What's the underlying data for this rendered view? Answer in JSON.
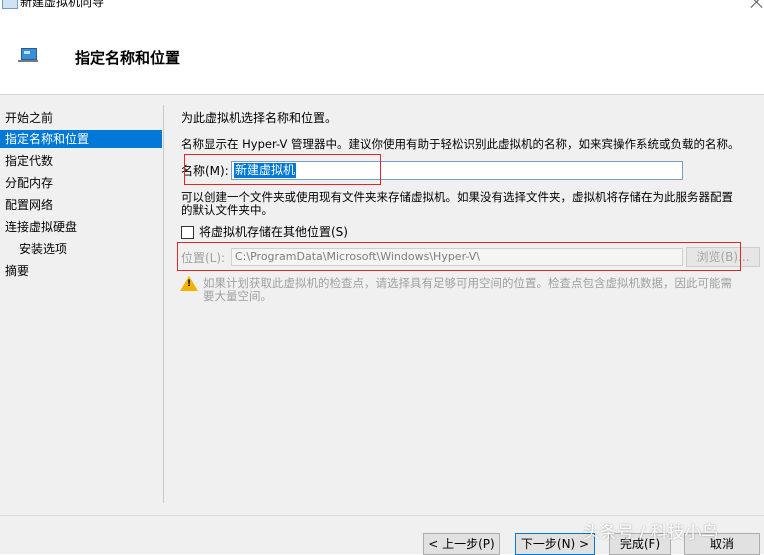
{
  "window": {
    "title": "新建虚拟机向导",
    "close_icon": "close-icon"
  },
  "header": {
    "heading": "指定名称和位置",
    "icon": "virtual-machine-icon"
  },
  "nav": {
    "items": [
      {
        "label": "开始之前",
        "selected": false,
        "indent": false
      },
      {
        "label": "指定名称和位置",
        "selected": true,
        "indent": false
      },
      {
        "label": "指定代数",
        "selected": false,
        "indent": false
      },
      {
        "label": "分配内存",
        "selected": false,
        "indent": false
      },
      {
        "label": "配置网络",
        "selected": false,
        "indent": false
      },
      {
        "label": "连接虚拟硬盘",
        "selected": false,
        "indent": false
      },
      {
        "label": "安装选项",
        "selected": false,
        "indent": true
      },
      {
        "label": "摘要",
        "selected": false,
        "indent": false
      }
    ]
  },
  "main": {
    "intro": "为此虚拟机选择名称和位置。",
    "name_desc": "名称显示在 Hyper-V 管理器中。建议你使用有助于轻松识别此虚拟机的名称，如来宾操作系统或负载的名称。",
    "name_label": "名称(M):",
    "name_value": "新建虚拟机",
    "folder_desc_line1": "可以创建一个文件夹或使用现有文件夹来存储虚拟机。如果没有选择文件夹，虚拟机将存储在为此服务器配置",
    "folder_desc_line2": "的默认文件夹中。",
    "store_checkbox_label": "将虚拟机存储在其他位置(S)",
    "store_checkbox_checked": false,
    "location_label": "位置(L):",
    "location_value": "C:\\ProgramData\\Microsoft\\Windows\\Hyper-V\\",
    "browse_label": "浏览(B)...",
    "warning_line1": "如果计划获取此虚拟机的检查点，请选择具有足够可用空间的位置。检查点包含虚拟机数据，因此可能需",
    "warning_line2": "要大量空间。",
    "warning_icon": "warning-icon"
  },
  "footer": {
    "prev_label": "< 上一步(P)",
    "next_label": "下一步(N) >",
    "finish_label": "完成(F)",
    "cancel_label": "取消"
  },
  "watermark": "头条号 / 科技小鸟",
  "colors": {
    "selection": "#0078d7",
    "highlight_box": "#e0262a",
    "panel_bg": "#f0f0f0",
    "warning": "#f0b400"
  }
}
